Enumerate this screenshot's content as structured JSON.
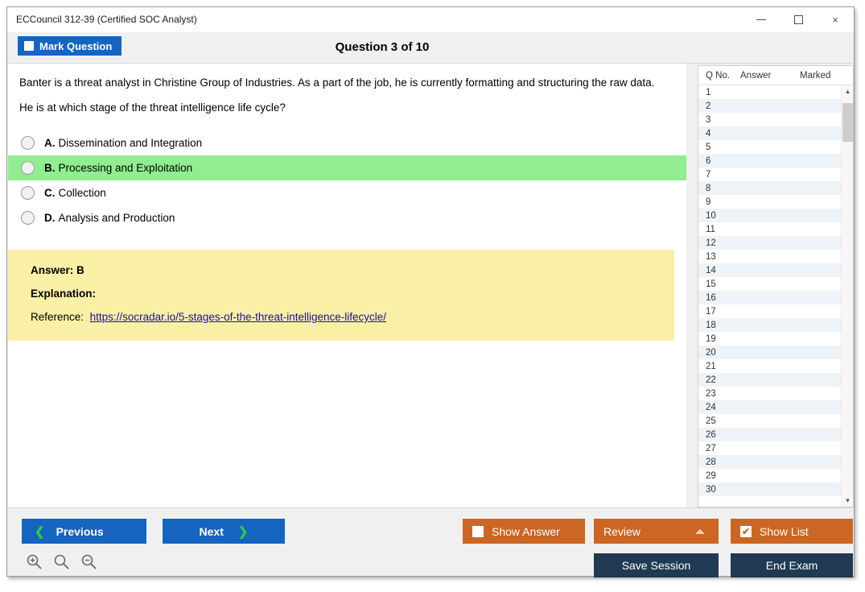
{
  "window": {
    "title": "ECCouncil 312-39 (Certified SOC Analyst)",
    "minimize_label": "Minimize",
    "maximize_label": "Maximize",
    "close_label": "×"
  },
  "topbar": {
    "mark_question_label": "Mark Question",
    "question_counter": "Question 3 of 10"
  },
  "question": {
    "paragraph1": "Banter is a threat analyst in Christine Group of Industries. As a part of the job, he is currently formatting and structuring the raw data.",
    "paragraph2": "He is at which stage of the threat intelligence life cycle?",
    "options": [
      {
        "letter": "A.",
        "text": "Dissemination and Integration",
        "correct": false
      },
      {
        "letter": "B.",
        "text": "Processing and Exploitation",
        "correct": true
      },
      {
        "letter": "C.",
        "text": "Collection",
        "correct": false
      },
      {
        "letter": "D.",
        "text": "Analysis and Production",
        "correct": false
      }
    ]
  },
  "answer_panel": {
    "answer_label": "Answer: B",
    "explanation_label": "Explanation:",
    "reference_label": "Reference:",
    "reference_url": "https://socradar.io/5-stages-of-the-threat-intelligence-lifecycle/"
  },
  "list_panel": {
    "columns": [
      "Q No.",
      "Answer",
      "Marked"
    ],
    "rows": [
      {
        "q": "1",
        "answer": "",
        "marked": ""
      },
      {
        "q": "2",
        "answer": "",
        "marked": ""
      },
      {
        "q": "3",
        "answer": "",
        "marked": ""
      },
      {
        "q": "4",
        "answer": "",
        "marked": ""
      },
      {
        "q": "5",
        "answer": "",
        "marked": ""
      },
      {
        "q": "6",
        "answer": "",
        "marked": ""
      },
      {
        "q": "7",
        "answer": "",
        "marked": ""
      },
      {
        "q": "8",
        "answer": "",
        "marked": ""
      },
      {
        "q": "9",
        "answer": "",
        "marked": ""
      },
      {
        "q": "10",
        "answer": "",
        "marked": ""
      },
      {
        "q": "11",
        "answer": "",
        "marked": ""
      },
      {
        "q": "12",
        "answer": "",
        "marked": ""
      },
      {
        "q": "13",
        "answer": "",
        "marked": ""
      },
      {
        "q": "14",
        "answer": "",
        "marked": ""
      },
      {
        "q": "15",
        "answer": "",
        "marked": ""
      },
      {
        "q": "16",
        "answer": "",
        "marked": ""
      },
      {
        "q": "17",
        "answer": "",
        "marked": ""
      },
      {
        "q": "18",
        "answer": "",
        "marked": ""
      },
      {
        "q": "19",
        "answer": "",
        "marked": ""
      },
      {
        "q": "20",
        "answer": "",
        "marked": ""
      },
      {
        "q": "21",
        "answer": "",
        "marked": ""
      },
      {
        "q": "22",
        "answer": "",
        "marked": ""
      },
      {
        "q": "23",
        "answer": "",
        "marked": ""
      },
      {
        "q": "24",
        "answer": "",
        "marked": ""
      },
      {
        "q": "25",
        "answer": "",
        "marked": ""
      },
      {
        "q": "26",
        "answer": "",
        "marked": ""
      },
      {
        "q": "27",
        "answer": "",
        "marked": ""
      },
      {
        "q": "28",
        "answer": "",
        "marked": ""
      },
      {
        "q": "29",
        "answer": "",
        "marked": ""
      },
      {
        "q": "30",
        "answer": "",
        "marked": ""
      }
    ]
  },
  "footer": {
    "previous_label": "Previous",
    "next_label": "Next",
    "show_answer_label": "Show Answer",
    "show_answer_checked": false,
    "review_label": "Review",
    "show_list_label": "Show List",
    "show_list_checked": true,
    "show_list_tick": "✔",
    "save_session_label": "Save Session",
    "end_exam_label": "End Exam",
    "zoom_in_name": "zoom-in-icon",
    "zoom_reset_name": "zoom-reset-icon",
    "zoom_out_name": "zoom-out-icon"
  },
  "colors": {
    "primary_blue": "#1565c0",
    "accent_orange": "#cc6622",
    "dark_navy": "#1f3a52",
    "correct_green": "#90EE90",
    "answer_yellow": "#FAF0A5",
    "link_blue": "#1a0dab",
    "chevron_green": "#2ecc40"
  }
}
